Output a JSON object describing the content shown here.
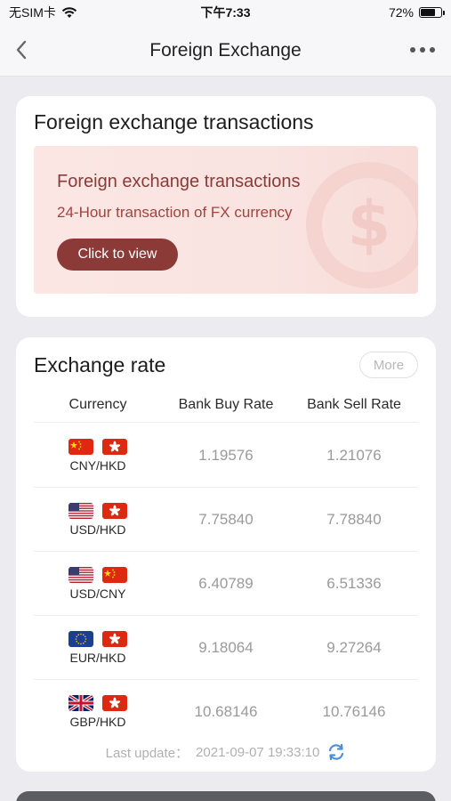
{
  "status_bar": {
    "carrier": "无SIM卡",
    "time": "下午7:33",
    "battery_pct": "72%",
    "battery_level": 0.72,
    "wifi_icon": "wifi-icon"
  },
  "nav": {
    "title": "Foreign Exchange",
    "back_icon": "chevron-left-icon",
    "more_icon": "more-dots-icon"
  },
  "transactions_card": {
    "title": "Foreign exchange transactions",
    "banner_title": "Foreign exchange transactions",
    "banner_subtitle": "24-Hour transaction of FX currency",
    "button_label": "Click to view",
    "button_color": "#8b3a38"
  },
  "rates_card": {
    "title": "Exchange rate",
    "more_label": "More",
    "headers": {
      "currency": "Currency",
      "buy": "Bank Buy Rate",
      "sell": "Bank Sell Rate"
    },
    "rows": [
      {
        "pair": "CNY/HKD",
        "flags": [
          "cn",
          "hk"
        ],
        "buy": "1.19576",
        "sell": "1.21076"
      },
      {
        "pair": "USD/HKD",
        "flags": [
          "us",
          "hk"
        ],
        "buy": "7.75840",
        "sell": "7.78840"
      },
      {
        "pair": "USD/CNY",
        "flags": [
          "us",
          "cn"
        ],
        "buy": "6.40789",
        "sell": "6.51336"
      },
      {
        "pair": "EUR/HKD",
        "flags": [
          "eu",
          "hk"
        ],
        "buy": "9.18064",
        "sell": "9.27264"
      },
      {
        "pair": "GBP/HKD",
        "flags": [
          "gb",
          "hk"
        ],
        "buy": "10.68146",
        "sell": "10.76146"
      }
    ],
    "last_update_label": "Last update：",
    "last_update_value": "2021-09-07 19:33:10",
    "refresh_icon": "refresh-icon"
  }
}
